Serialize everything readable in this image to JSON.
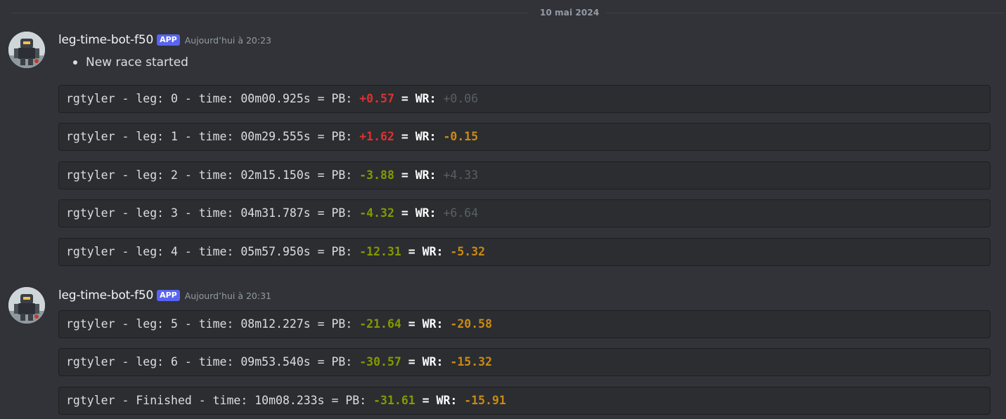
{
  "date_divider": "10 mai 2024",
  "messages": [
    {
      "username": "leg-time-bot-f50",
      "badge": "APP",
      "timestamp": "Aujourd’hui à 20:23",
      "bullet": "New race started",
      "lines": [
        {
          "prefix": "rgtyler - leg: 0 - time: 00m00.925s = PB: ",
          "pb": "+0.57",
          "pb_color": "red",
          "sep": " = ",
          "wr_label": "WR:",
          "wr": "+0.06",
          "wr_color": "gray"
        },
        {
          "prefix": "rgtyler - leg: 1 - time: 00m29.555s = PB: ",
          "pb": "+1.62",
          "pb_color": "red",
          "sep": " = ",
          "wr_label": "WR:",
          "wr": "-0.15",
          "wr_color": "orange"
        },
        {
          "prefix": "rgtyler - leg: 2 - time: 02m15.150s = PB: ",
          "pb": "-3.88",
          "pb_color": "green",
          "sep": " = ",
          "wr_label": "WR:",
          "wr": "+4.33",
          "wr_color": "gray"
        },
        {
          "prefix": "rgtyler - leg: 3 - time: 04m31.787s = PB: ",
          "pb": "-4.32",
          "pb_color": "green",
          "sep": " = ",
          "wr_label": "WR:",
          "wr": "+6.64",
          "wr_color": "gray"
        },
        {
          "prefix": "rgtyler - leg: 4 - time: 05m57.950s = PB: ",
          "pb": "-12.31",
          "pb_color": "green",
          "sep": " = ",
          "wr_label": "WR:",
          "wr": "-5.32",
          "wr_color": "orange"
        }
      ]
    },
    {
      "username": "leg-time-bot-f50",
      "badge": "APP",
      "timestamp": "Aujourd’hui à 20:31",
      "lines": [
        {
          "prefix": "rgtyler - leg: 5 - time: 08m12.227s = PB: ",
          "pb": "-21.64",
          "pb_color": "green",
          "sep": " = ",
          "wr_label": "WR:",
          "wr": "-20.58",
          "wr_color": "orange"
        },
        {
          "prefix": "rgtyler - leg: 6 - time: 09m53.540s = PB: ",
          "pb": "-30.57",
          "pb_color": "green",
          "sep": " = ",
          "wr_label": "WR:",
          "wr": "-15.32",
          "wr_color": "orange"
        },
        {
          "prefix": "rgtyler - Finished - time: 10m08.233s = PB: ",
          "pb": "-31.61",
          "pb_color": "green",
          "sep": " = ",
          "wr_label": "WR:",
          "wr": "-15.91",
          "wr_color": "orange"
        }
      ]
    }
  ]
}
